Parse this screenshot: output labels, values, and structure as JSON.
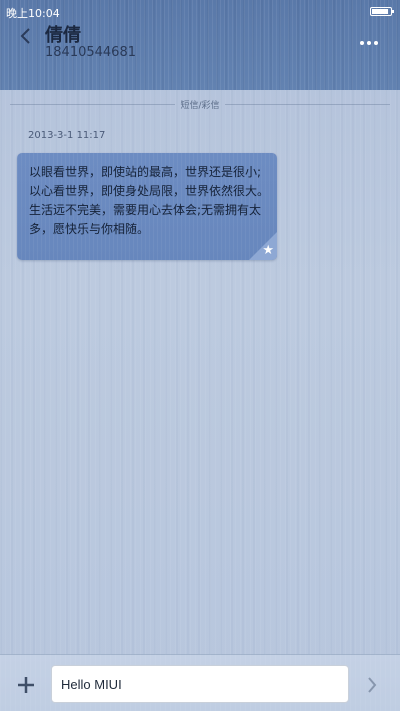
{
  "status_bar": {
    "time": "晚上10:04",
    "battery_icon": "battery-icon"
  },
  "header": {
    "back_icon": "chevron-left-icon",
    "contact_name": "倩倩",
    "contact_number": "18410544681",
    "more_icon": "more-dots-icon"
  },
  "conversation": {
    "section_label": "短信/彩信",
    "messages": [
      {
        "timestamp": "2013-3-1 11:17",
        "text": "以眼看世界，即使站的最高，世界还是很小;以心看世界，即使身处局限，世界依然很大。生活远不完美，需要用心去体会;无需拥有太多，愿快乐与你相随。",
        "starred": true,
        "star_icon": "star-icon"
      }
    ]
  },
  "input_bar": {
    "add_icon": "plus-icon",
    "input_value": "Hello MIUI",
    "send_icon": "send-arrow-icon"
  },
  "colors": {
    "header_bg": "#5d7cab",
    "bubble_bg": "#6b8ac0",
    "page_bg": "#b9c8df"
  }
}
